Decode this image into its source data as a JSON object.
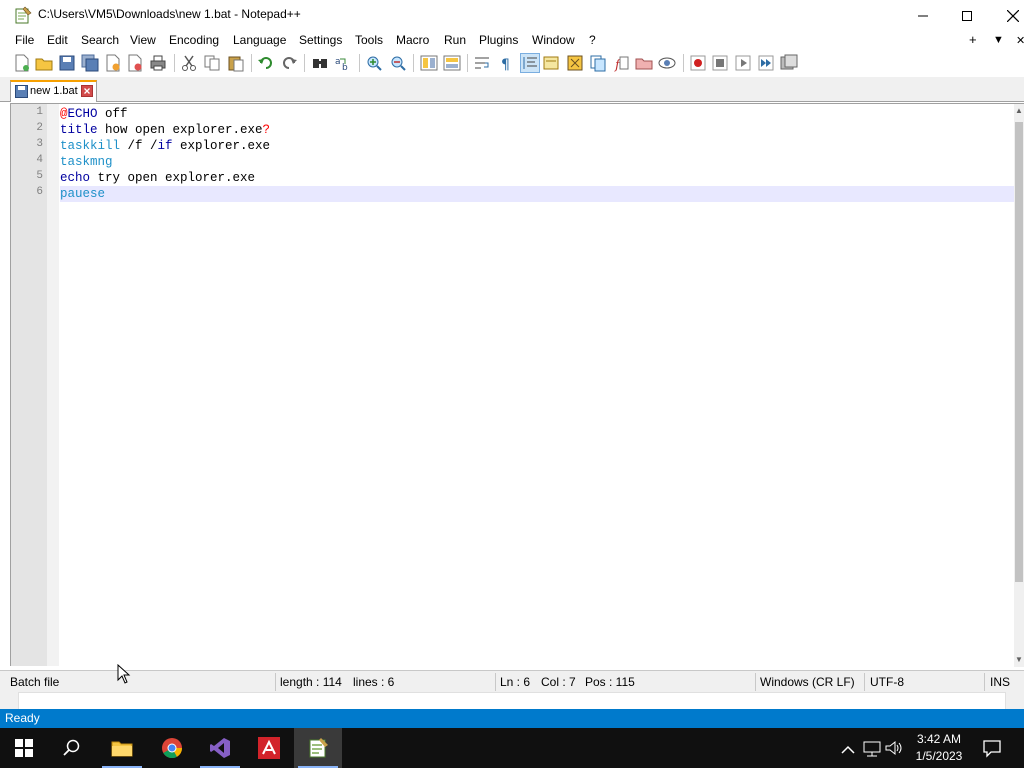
{
  "window": {
    "title": "C:\\Users\\VM5\\Downloads\\new 1.bat - Notepad++"
  },
  "menu": {
    "items": [
      "File",
      "Edit",
      "Search",
      "View",
      "Encoding",
      "Language",
      "Settings",
      "Tools",
      "Macro",
      "Run",
      "Plugins",
      "Window",
      "?"
    ],
    "plus": "+",
    "dropdown": "▼",
    "close": "✕"
  },
  "tabs": [
    {
      "label": "new 1.bat"
    }
  ],
  "editor": {
    "line_numbers": [
      "1",
      "2",
      "3",
      "4",
      "5",
      "6"
    ],
    "lines": [
      [
        {
          "t": "@",
          "c": "red"
        },
        {
          "t": "ECHO",
          "c": "kw"
        },
        {
          "t": " off",
          "c": ""
        }
      ],
      [
        {
          "t": "title",
          "c": "kw"
        },
        {
          "t": " how open explorer.exe",
          "c": ""
        },
        {
          "t": "?",
          "c": "red"
        }
      ],
      [
        {
          "t": "taskkill",
          "c": "cmd"
        },
        {
          "t": " /f /",
          "c": ""
        },
        {
          "t": "if",
          "c": "kw"
        },
        {
          "t": " explorer.exe",
          "c": ""
        }
      ],
      [
        {
          "t": "taskmng",
          "c": "cmd"
        }
      ],
      [
        {
          "t": "echo",
          "c": "kw"
        },
        {
          "t": " try open explorer.exe",
          "c": ""
        }
      ],
      [
        {
          "t": "pauese",
          "c": "cmd"
        }
      ]
    ],
    "current_line": 6
  },
  "status": {
    "file_type": "Batch file",
    "length": "length : 114",
    "lines": "lines : 6",
    "ln": "Ln : 6",
    "col": "Col : 7",
    "pos": "Pos : 115",
    "eol": "Windows (CR LF)",
    "encoding": "UTF-8",
    "mode": "INS"
  },
  "vs_status": {
    "ready": "Ready"
  },
  "taskbar": {
    "time": "3:42 AM",
    "date": "1/5/2023"
  },
  "colors": {
    "accent_blue": "#007acc",
    "tab_orange": "#f7a000",
    "current_line": "#e8e8ff",
    "keyword": "#0000a0",
    "command": "#1e90c8"
  }
}
